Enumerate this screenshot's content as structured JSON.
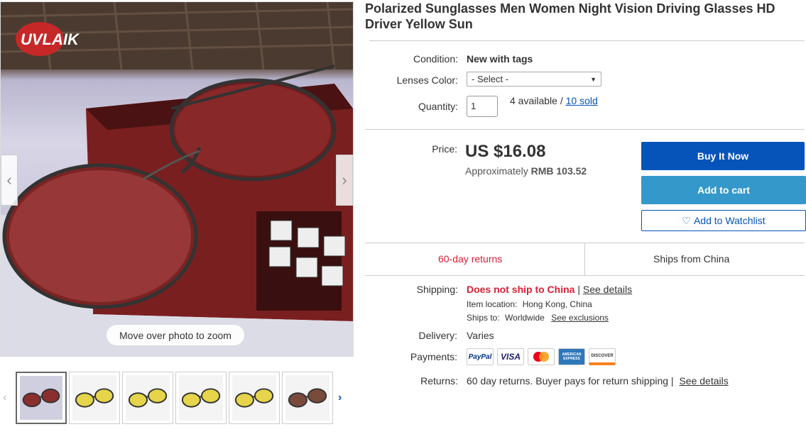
{
  "gallery": {
    "logo_text": "UVLAIK",
    "prev_arrow": "‹",
    "next_arrow": "›",
    "zoom_hint": "Move over photo to zoom",
    "thumb_prev": "‹",
    "thumb_next": "›",
    "thumbnails": [
      {
        "label": "thumbnail-1",
        "lens": "#8a2e2e"
      },
      {
        "label": "thumbnail-2",
        "lens": "#e6d44a"
      },
      {
        "label": "thumbnail-3",
        "lens": "#e6d44a"
      },
      {
        "label": "thumbnail-4",
        "lens": "#e6d44a"
      },
      {
        "label": "thumbnail-5",
        "lens": "#e6d44a"
      },
      {
        "label": "thumbnail-6",
        "lens": "#7a4a3a"
      }
    ]
  },
  "product": {
    "title": "Polarized Sunglasses Men Women Night Vision Driving Glasses HD Driver Yellow Sun"
  },
  "details": {
    "condition_label": "Condition:",
    "condition_value": "New with tags",
    "lenses_label": "Lenses Color:",
    "lenses_select": "- Select -",
    "quantity_label": "Quantity:",
    "quantity_value": "1",
    "available_text": "4 available /",
    "sold_link": "10 sold"
  },
  "price": {
    "label": "Price:",
    "value": "US $16.08",
    "approx_prefix": "Approximately",
    "approx_value": "RMB 103.52"
  },
  "actions": {
    "buy_now": "Buy It Now",
    "add_to_cart": "Add to cart",
    "watchlist": "Add to Watchlist",
    "watch_icon": "♡"
  },
  "highlights": {
    "returns": "60-day returns",
    "ships_from": "Ships from China"
  },
  "shipping": {
    "label": "Shipping:",
    "status": "Does not ship to China",
    "separator": "|",
    "see_details": "See details",
    "item_location_label": "Item location:",
    "item_location_value": "Hong Kong, China",
    "ships_to_label": "Ships to:",
    "ships_to_value": "Worldwide",
    "see_exclusions": "See exclusions"
  },
  "delivery": {
    "label": "Delivery:",
    "value": "Varies"
  },
  "payments": {
    "label": "Payments:",
    "methods": [
      "PayPal",
      "VISA",
      "MasterCard",
      "AMERICAN EXPRESS",
      "DISCOVER"
    ]
  },
  "returns": {
    "label": "Returns:",
    "value": "60 day returns. Buyer pays for return shipping |",
    "see_details": "See details"
  },
  "colors": {
    "accent_blue": "#0654ba",
    "cart_blue": "#3498ca",
    "alert_red": "#dd1e31"
  }
}
